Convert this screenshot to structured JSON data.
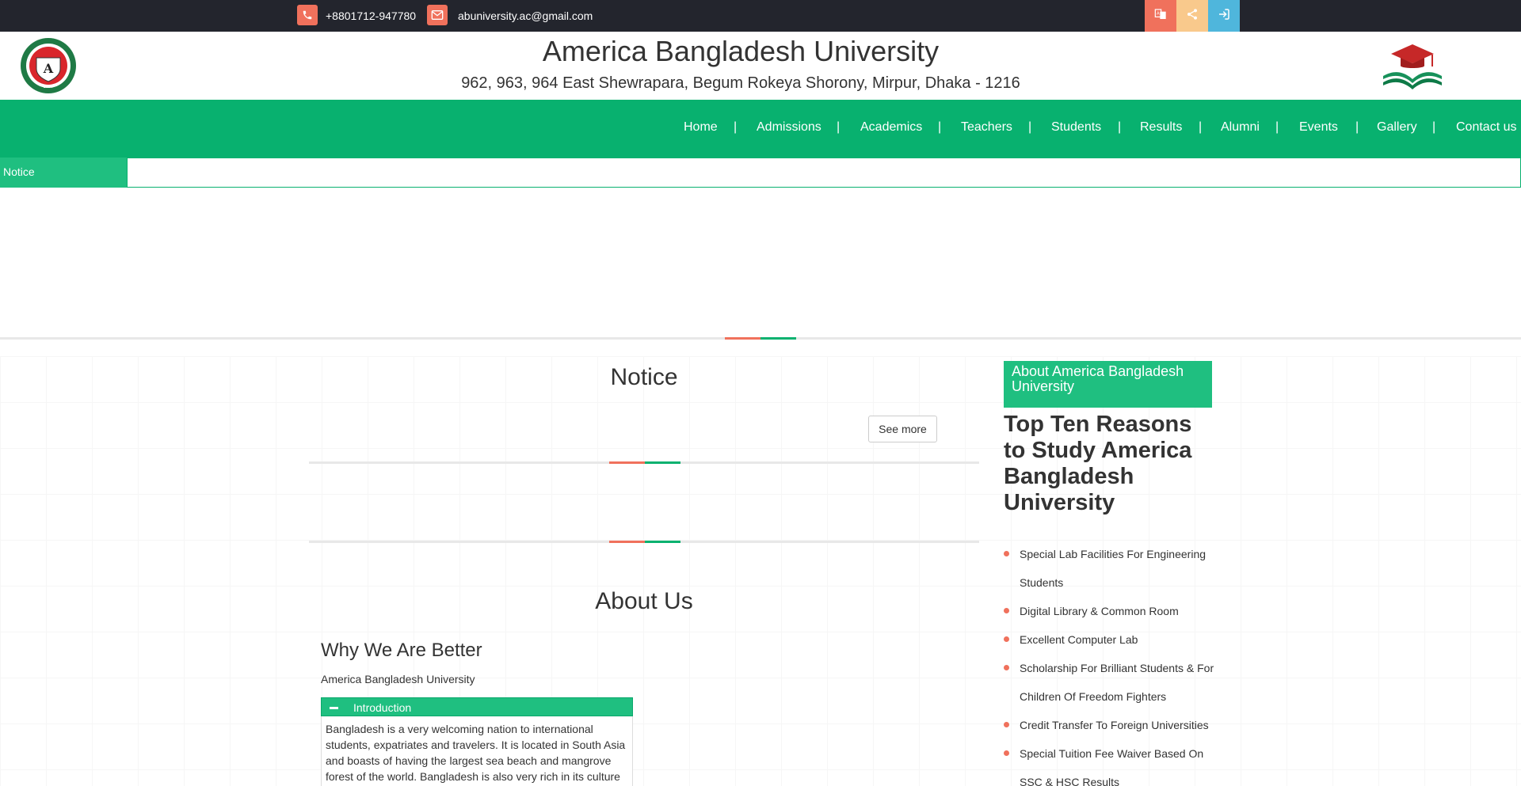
{
  "topbar": {
    "phone": "+8801712-947780",
    "email": "abuniversity.ac@gmail.com",
    "icons": [
      "phone-icon",
      "envelope-icon",
      "translate-icon",
      "share-icon",
      "login-icon"
    ],
    "colors": {
      "translate": "#f0715c",
      "share": "#f9c98c",
      "login": "#4fb6dc"
    }
  },
  "header": {
    "title": "America Bangladesh University",
    "address": "962, 963, 964 East Shewrapara, Begum Rokeya Shorony, Mirpur, Dhaka - 1216"
  },
  "nav": {
    "items": [
      "Home",
      "Admissions",
      "Academics",
      "Teachers",
      "Students",
      "Results",
      "Alumni",
      "Events",
      "Gallery",
      "Contact us"
    ],
    "separator": "|"
  },
  "ticker": {
    "label": "Notice"
  },
  "notice_section": {
    "heading": "Notice",
    "see_more": "See more"
  },
  "about_section": {
    "heading": "About Us",
    "why_title": "Why We Are Better",
    "subtitle": "America Bangladesh University",
    "accordion_title": "Introduction",
    "accordion_text": "Bangladesh is a very welcoming nation to international students, expatriates and travelers. It is located in South Asia and boasts of having the largest sea beach and mangrove forest of the world. Bangladesh is also very rich in its culture"
  },
  "sidebar": {
    "heading": "About America Bangladesh University",
    "title": "Top Ten Reasons to Study America Bangladesh University",
    "reasons": [
      "Special Lab Facilities For Engineering Students",
      "Digital Library & Common Room",
      "Excellent Computer Lab",
      "Scholarship For Brilliant Students & For Children Of Freedom Fighters",
      "Credit Transfer To Foreign Universities",
      "Special Tuition  Fee Waiver Based On SSC & HSC Results"
    ]
  },
  "colors": {
    "brand_green": "#08b16f",
    "accent_red": "#f0715c",
    "dark_bar": "#23252d"
  }
}
